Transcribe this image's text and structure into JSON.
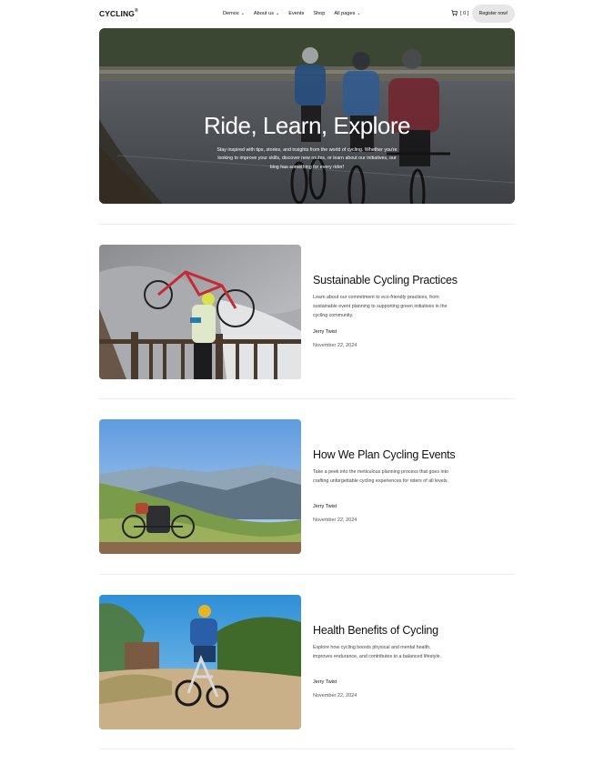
{
  "header": {
    "logo": "CYCLING",
    "logo_mark": "®",
    "nav": [
      {
        "label": "Demos",
        "dropdown": true
      },
      {
        "label": "About us",
        "dropdown": true
      },
      {
        "label": "Events",
        "dropdown": false
      },
      {
        "label": "Shop",
        "dropdown": false
      },
      {
        "label": "All pages",
        "dropdown": true
      }
    ],
    "cart_icon": "cart-icon",
    "cart_count": "[ 0 ]",
    "register_label": "Register now!"
  },
  "hero": {
    "title": "Ride, Learn, Explore",
    "text": "Stay inspired with tips, stories, and insights from the world of cycling. Whether you're looking to improve your skills, discover new routes, or learn about our initiatives, our blog has something for every rider!"
  },
  "posts": [
    {
      "title": "Sustainable Cycling Practices",
      "description": "Learn about our commitment to eco-friendly practices, from sustainable event planning to supporting green initiatives in the cycling community.",
      "author": "Jerry Twist",
      "date": "November 22, 2024"
    },
    {
      "title": "How We Plan Cycling Events",
      "description": "Take a peek into the meticulous planning process that goes into crafting unforgettable cycling experiences for riders of all levels.",
      "author": "Jerry Twist",
      "date": "November 22, 2024"
    },
    {
      "title": "Health Benefits of Cycling",
      "description": "Explore how cycling boosts physical and mental health, improves endurance, and contributes to a balanced lifestyle.",
      "author": "Jerry Twist",
      "date": "November 22, 2024"
    }
  ],
  "colors": {
    "text": "#111111",
    "button_bg": "#e6e6e6",
    "divider": "#ededed"
  }
}
